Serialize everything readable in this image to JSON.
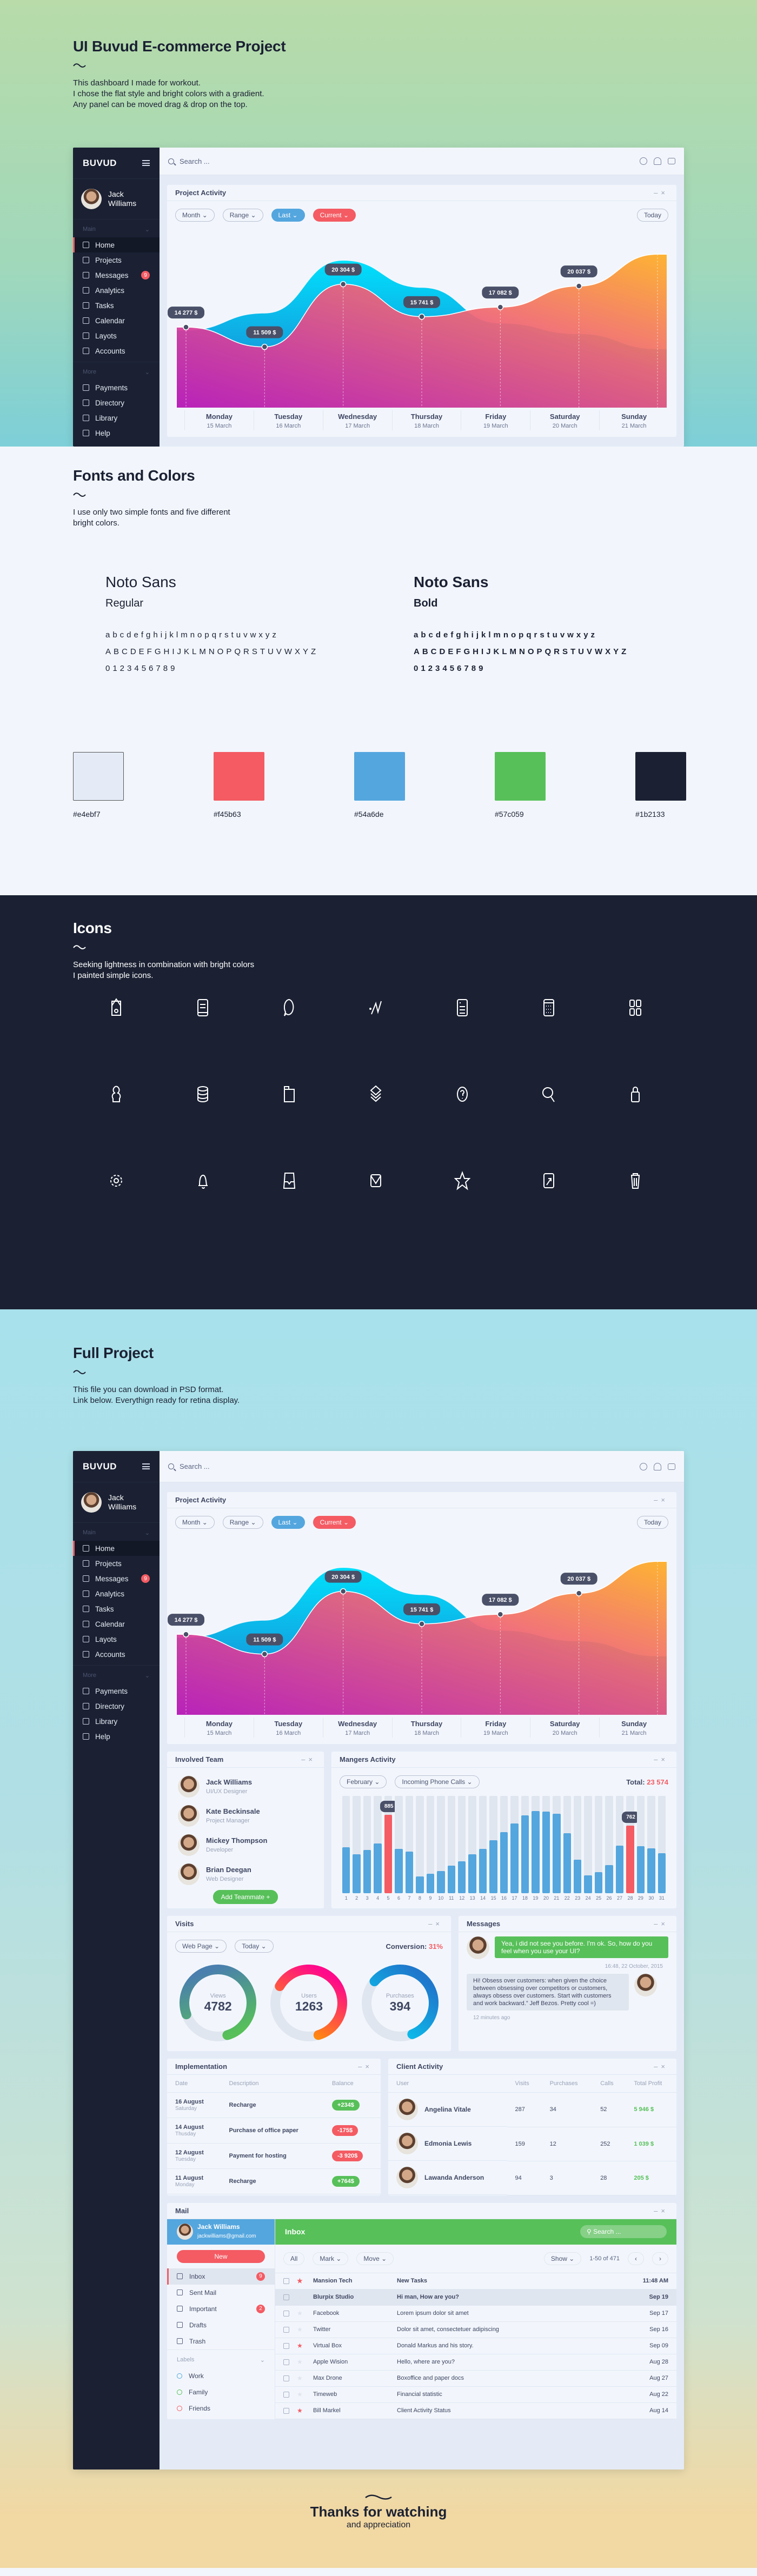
{
  "hero": {
    "title": "UI Buvud E-commerce Project",
    "lines": [
      "This dashboard I made for workout.",
      "I chose the flat style and bright colors with a gradient.",
      "Any panel can be moved drag & drop on the top."
    ]
  },
  "app": {
    "brand": "BUVUD",
    "user": {
      "first": "Jack",
      "last": "Williams"
    },
    "search_placeholder": "Search ...",
    "groups": {
      "main": "Main",
      "more": "More"
    },
    "nav_main": [
      {
        "label": "Home",
        "icon": "home-icon"
      },
      {
        "label": "Projects",
        "icon": "projects-icon"
      },
      {
        "label": "Messages",
        "icon": "messages-icon",
        "badge": "9"
      },
      {
        "label": "Analytics",
        "icon": "analytics-icon"
      },
      {
        "label": "Tasks",
        "icon": "tasks-icon"
      },
      {
        "label": "Calendar",
        "icon": "calendar-icon"
      },
      {
        "label": "Layots",
        "icon": "layouts-icon"
      },
      {
        "label": "Accounts",
        "icon": "accounts-icon"
      }
    ],
    "nav_more": [
      {
        "label": "Payments",
        "icon": "payments-icon"
      },
      {
        "label": "Directory",
        "icon": "directory-icon"
      },
      {
        "label": "Library",
        "icon": "library-icon"
      },
      {
        "label": "Help",
        "icon": "help-icon"
      }
    ],
    "top_icons": [
      "gear-icon",
      "bell-icon",
      "lock-icon"
    ]
  },
  "activity": {
    "title": "Project Activity",
    "filters": [
      "Month",
      "Range",
      "Last",
      "Current"
    ],
    "today": "Today",
    "days": [
      {
        "d": "Monday",
        "m": "15 March"
      },
      {
        "d": "Tuesday",
        "m": "16 March"
      },
      {
        "d": "Wednesday",
        "m": "17 March"
      },
      {
        "d": "Thursday",
        "m": "18 March"
      },
      {
        "d": "Friday",
        "m": "19 March"
      },
      {
        "d": "Saturday",
        "m": "20 March"
      },
      {
        "d": "Sunday",
        "m": "21 March"
      }
    ]
  },
  "chart_data": [
    {
      "type": "area",
      "title": "Project Activity",
      "x": [
        "15 March",
        "16 March",
        "17 March",
        "18 March",
        "19 March",
        "20 March",
        "21 March"
      ],
      "series": [
        {
          "name": "Current",
          "values": [
            14277,
            11509,
            20304,
            15741,
            17082,
            20037,
            24500
          ],
          "labels": [
            "14 277 $",
            "11 509 $",
            "20 304 $",
            "15 741 $",
            "17 082 $",
            "20 037 $",
            ""
          ]
        },
        {
          "name": "Last",
          "values": [
            13800,
            16200,
            23600,
            19800,
            14800,
            13300,
            11200
          ]
        }
      ],
      "ylim": [
        3000,
        28000
      ],
      "grid": false
    },
    {
      "type": "bar",
      "title": "Mangers Activity",
      "categories": [
        "1",
        "2",
        "3",
        "4",
        "5",
        "6",
        "7",
        "8",
        "9",
        "10",
        "11",
        "12",
        "13",
        "14",
        "15",
        "16",
        "17",
        "18",
        "19",
        "20",
        "21",
        "22",
        "23",
        "24",
        "25",
        "26",
        "27",
        "28",
        "29",
        "30",
        "31"
      ],
      "values": [
        520,
        440,
        490,
        560,
        885,
        500,
        470,
        190,
        220,
        250,
        310,
        360,
        440,
        500,
        600,
        690,
        790,
        880,
        930,
        920,
        900,
        680,
        380,
        200,
        240,
        320,
        540,
        762,
        530,
        510,
        450
      ],
      "highlight": {
        "5": "885",
        "28": "762"
      },
      "ylim": [
        0,
        1100
      ]
    }
  ],
  "team": {
    "title": "Involved Team",
    "members": [
      {
        "name": "Jack Williams",
        "role": "UI/UX Designer"
      },
      {
        "name": "Kate Beckinsale",
        "role": "Project Manager"
      },
      {
        "name": "Mickey Thompson",
        "role": "Developer"
      },
      {
        "name": "Brian Deegan",
        "role": "Web Designer"
      }
    ],
    "add": "Add Teammate +"
  },
  "managers": {
    "title": "Mangers Activity",
    "filters": [
      "February",
      "Incoming Phone Calls"
    ],
    "total_label": "Total:",
    "total": "23 574"
  },
  "visits": {
    "title": "Visits",
    "filters": [
      "Web Page",
      "Today"
    ],
    "conv_label": "Conversion:",
    "conv": "31%",
    "donuts": [
      {
        "label": "Views",
        "value": "4782",
        "fraction": 0.76
      },
      {
        "label": "Users",
        "value": "1263",
        "fraction": 0.62
      },
      {
        "label": "Purchases",
        "value": "394",
        "fraction": 0.58
      }
    ]
  },
  "messages": {
    "title": "Messages",
    "items": [
      {
        "text": "Yea, i did not see you before. I'm ok. So, how do you feel when you use your UI?",
        "time": "16:48, 22 October, 2015"
      },
      {
        "text": "Hi! Obsess over customers: when given the choice between obsessing over competitors or customers, always obsess over customers. Start with customers and work backward.” Jeff Bezos. Pretty cool =)",
        "time": "12 minutes ago"
      }
    ]
  },
  "impl": {
    "title": "Implementation",
    "cols": [
      "Date",
      "Description",
      "Balance"
    ],
    "rows": [
      {
        "date": "16 August",
        "wd": "Saturday",
        "desc": "Recharge",
        "bal": "+234$",
        "pos": true
      },
      {
        "date": "14 August",
        "wd": "Thusday",
        "desc": "Purchase of office paper",
        "bal": "-175$",
        "pos": false
      },
      {
        "date": "12 August",
        "wd": "Tuesday",
        "desc": "Payment for hosting",
        "bal": "-3 920$",
        "pos": false
      },
      {
        "date": "11 August",
        "wd": "Monday",
        "desc": "Recharge",
        "bal": "+764$",
        "pos": true
      }
    ]
  },
  "clients": {
    "title": "Client Activity",
    "cols": [
      "User",
      "Visits",
      "Purchases",
      "Calls",
      "Total Profit"
    ],
    "rows": [
      [
        "Angelina Vitale",
        "287",
        "34",
        "52",
        "5 946 $"
      ],
      [
        "Edmonia Lewis",
        "159",
        "12",
        "252",
        "1 039 $"
      ],
      [
        "Lawanda Anderson",
        "94",
        "3",
        "28",
        "205 $"
      ]
    ]
  },
  "mail": {
    "title": "Mail",
    "user": "Jack Williams",
    "email": "jackwilliams@gmail.com",
    "inbox": "Inbox",
    "search": "Search ...",
    "new": "New",
    "folders": [
      {
        "label": "Inbox",
        "badge": "9"
      },
      {
        "label": "Sent Mail"
      },
      {
        "label": "Important",
        "badge": "2"
      },
      {
        "label": "Drafts"
      },
      {
        "label": "Trash"
      }
    ],
    "labels_title": "Labels",
    "labels": [
      {
        "label": "Work",
        "color": "#54a6de"
      },
      {
        "label": "Family",
        "color": "#57c059"
      },
      {
        "label": "Friends",
        "color": "#f45b63"
      }
    ],
    "toolbar": [
      "All",
      "Mark",
      "Move"
    ],
    "show": "Show",
    "range": "1-50 of 471",
    "rows": [
      {
        "from": "Mansion Tech",
        "subj": "New Tasks",
        "date": "11:48 AM",
        "star": true,
        "bold": true
      },
      {
        "from": "Blurpix Studio",
        "subj": "Hi man, How are you?",
        "date": "Sep 19",
        "star": false,
        "bold": true,
        "sel": true
      },
      {
        "from": "Facebook",
        "subj": "Lorem ipsum dolor sit amet",
        "date": "Sep 17",
        "star": false
      },
      {
        "from": "Twitter",
        "subj": "Dolor sit amet, consectetuer adipiscing",
        "date": "Sep 16",
        "star": false
      },
      {
        "from": "Virtual Box",
        "subj": "Donald Markus and his story.",
        "date": "Sep 09",
        "star": true
      },
      {
        "from": "Apple Wision",
        "subj": "Hello, where are you?",
        "date": "Aug 28",
        "star": false
      },
      {
        "from": "Max Drone",
        "subj": "Boxoffice and paper docs",
        "date": "Aug 27",
        "star": false
      },
      {
        "from": "Timeweb",
        "subj": "Financial statistic",
        "date": "Aug 22",
        "star": false
      },
      {
        "from": "Bill Markel",
        "subj": "Client Activity Status",
        "date": "Aug 14",
        "star": true
      }
    ]
  },
  "fonts": {
    "title": "Fonts and Colors",
    "lines": [
      "I use only two simple fonts and five different",
      "bright colors."
    ],
    "regular": {
      "name": "Noto Sans",
      "weight": "Regular"
    },
    "bold": {
      "name": "Noto Sans",
      "weight": "Bold"
    },
    "lower": "abcdefghijklmnopqrstuvwxyz",
    "upper": "ABCDEFGHIJKLMNOPQRSTUVWXYZ",
    "digits": "0123456789",
    "colors": [
      "#e4ebf7",
      "#f45b63",
      "#54a6de",
      "#57c059",
      "#1b2133"
    ]
  },
  "icons": {
    "title": "Icons",
    "lines": [
      "Seeking lightness in combination with bright colors",
      "I painted simple icons."
    ],
    "list": [
      "home-icon",
      "projects-icon",
      "chat-icon",
      "analytics-icon",
      "tasks-icon",
      "calendar-icon",
      "layouts-icon",
      "accounts-icon",
      "payments-icon",
      "folder-icon",
      "library-icon",
      "help-icon",
      "search-icon",
      "lock-icon",
      "gear-icon",
      "bell-icon",
      "inbox-icon",
      "mail-icon",
      "star-icon",
      "drafts-icon",
      "trash-icon"
    ]
  },
  "full": {
    "title": "Full Project",
    "lines": [
      "This file you can download in PSD format.",
      "Link below. Everythign ready for retina display."
    ]
  },
  "footer": {
    "title": "Thanks for watching",
    "sub": "and appreciation"
  }
}
